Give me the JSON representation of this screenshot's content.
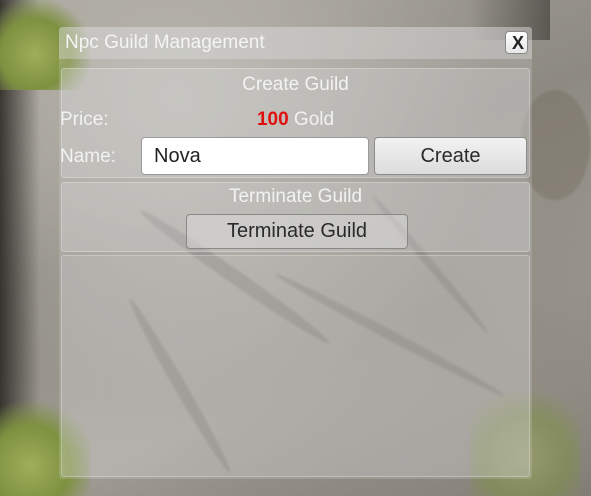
{
  "window": {
    "title": "Npc Guild Management",
    "close_label": "X"
  },
  "create_section": {
    "heading": "Create Guild",
    "price_label": "Price:",
    "price_value": "100",
    "price_unit": "Gold",
    "name_label": "Name:",
    "name_value": "Nova",
    "create_button": "Create"
  },
  "terminate_section": {
    "heading": "Terminate Guild",
    "terminate_button": "Terminate Guild"
  },
  "colors": {
    "price_value": "#e01010",
    "panel_text": "#f2f2f2"
  },
  "icons": {
    "close": "close-icon"
  }
}
